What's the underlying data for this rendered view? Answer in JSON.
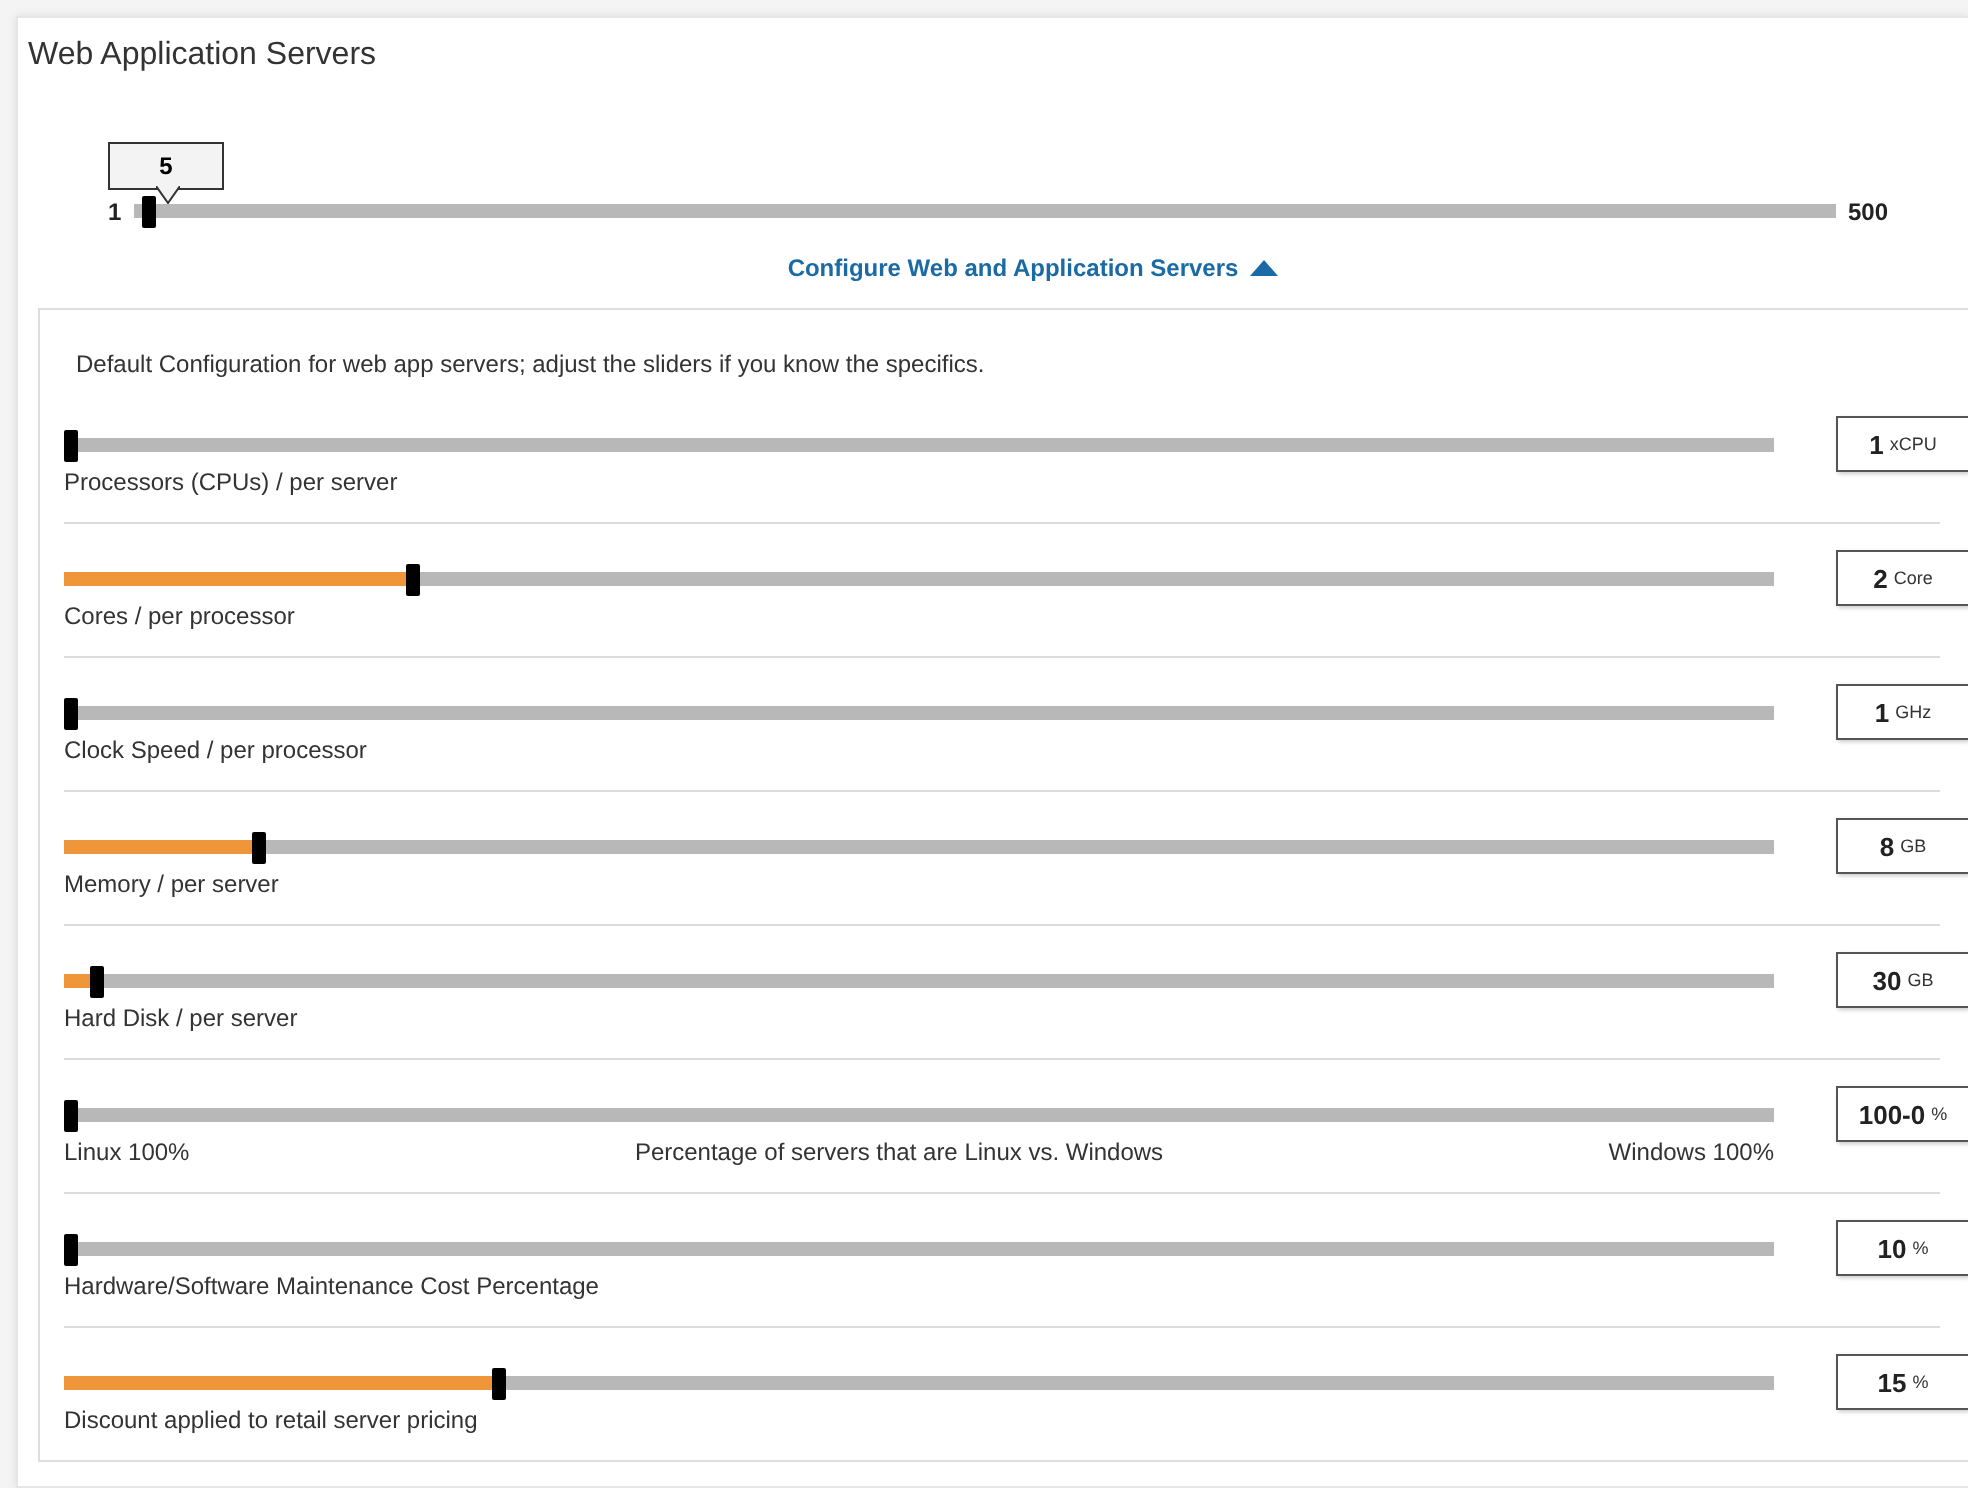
{
  "title": "Web Application Servers",
  "server_count": {
    "value": "5",
    "min": "1",
    "max": "500",
    "level": 0.005
  },
  "configure_link": {
    "label": "Configure Web and Application Servers",
    "expanded": true
  },
  "description": "Default Configuration for web app servers; adjust the sliders if you know the specifics.",
  "sliders": [
    {
      "kind": "single",
      "label": "Processors (CPUs) / per server",
      "level": 0,
      "value": "1",
      "unit": "xCPU"
    },
    {
      "kind": "single",
      "label": "Cores / per processor",
      "level": 0.2,
      "value": "2",
      "unit": "Core"
    },
    {
      "kind": "single",
      "label": "Clock Speed / per processor",
      "level": 0,
      "value": "1",
      "unit": "GHz"
    },
    {
      "kind": "single",
      "label": "Memory / per server",
      "level": 0.11,
      "value": "8",
      "unit": "GB"
    },
    {
      "kind": "single",
      "label": "Hard Disk / per server",
      "level": 0.015,
      "value": "30",
      "unit": "GB"
    },
    {
      "kind": "split",
      "left_label": "Linux 100%",
      "center_label": "Percentage of servers that are Linux vs. Windows",
      "right_label": "Windows 100%",
      "level": 0,
      "value": "100-0",
      "unit": "%"
    },
    {
      "kind": "single",
      "label": "Hardware/Software Maintenance Cost Percentage",
      "level": 0,
      "value": "10",
      "unit": "%"
    },
    {
      "kind": "single",
      "label": "Discount applied to retail server pricing",
      "level": 0.25,
      "value": "15",
      "unit": "%"
    }
  ]
}
